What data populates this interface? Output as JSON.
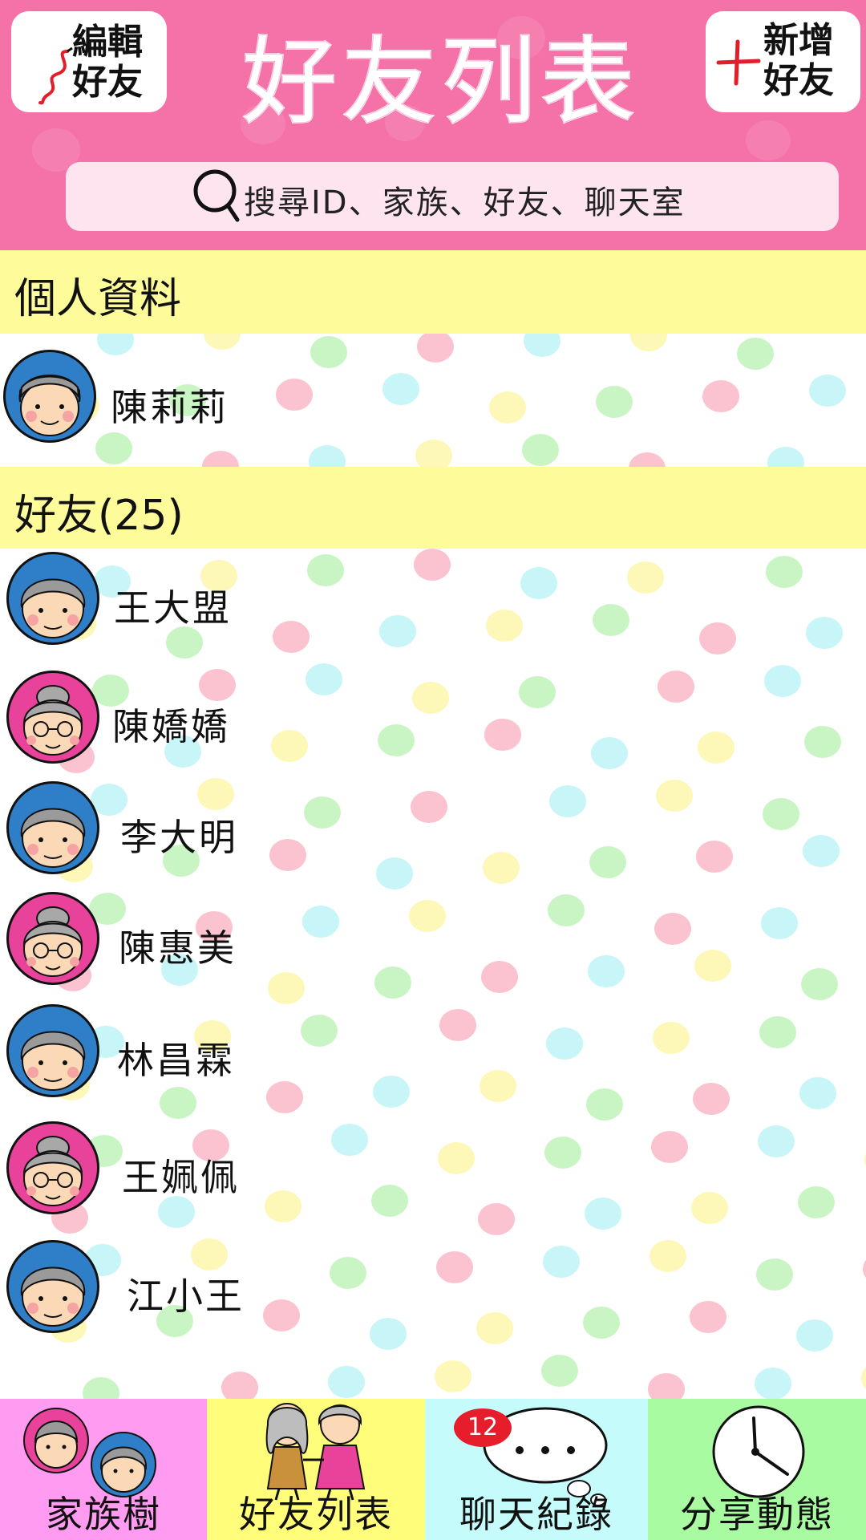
{
  "header": {
    "title": "好友列表",
    "edit_button": {
      "line1": "編輯",
      "line2": "好友"
    },
    "add_button": {
      "line1": "新增",
      "line2": "好友"
    },
    "search": {
      "placeholder": "搜尋ID、家族、好友、聊天室"
    }
  },
  "sections": {
    "profile": {
      "label": "個人資料"
    },
    "friends": {
      "label": "好友(25)"
    }
  },
  "profile": {
    "name": "陳莉莉",
    "avatar": "grandma-short-hair"
  },
  "friends": [
    {
      "name": "王大盟",
      "avatar": "grandpa-blue"
    },
    {
      "name": "陳嬌嬌",
      "avatar": "grandma-bun-pink"
    },
    {
      "name": "李大明",
      "avatar": "grandpa-blue"
    },
    {
      "name": "陳惠美",
      "avatar": "grandma-bun-pink"
    },
    {
      "name": "林昌霖",
      "avatar": "grandpa-blue"
    },
    {
      "name": "王姵佩",
      "avatar": "grandma-bun-pink"
    },
    {
      "name": "江小王",
      "avatar": "grandpa-blue"
    }
  ],
  "nav": {
    "tabs": [
      {
        "label": "家族樹",
        "icon": "family-couple-icon",
        "color": "#ff9cf2"
      },
      {
        "label": "好友列表",
        "icon": "friends-walking-icon",
        "color": "#fffd7a",
        "active": true
      },
      {
        "label": "聊天紀錄",
        "icon": "speech-bubble-icon",
        "color": "#c6fbfb",
        "badge": "12"
      },
      {
        "label": "分享動態",
        "icon": "clock-icon",
        "color": "#a8fba0"
      }
    ]
  },
  "colors": {
    "header_pink": "#f472a8",
    "section_yellow": "#fefb9a",
    "badge_red": "#e61d2b",
    "dot_colors": [
      "#fbc3cf",
      "#c8f5f7",
      "#fdf8b8",
      "#c9f5c4"
    ]
  }
}
